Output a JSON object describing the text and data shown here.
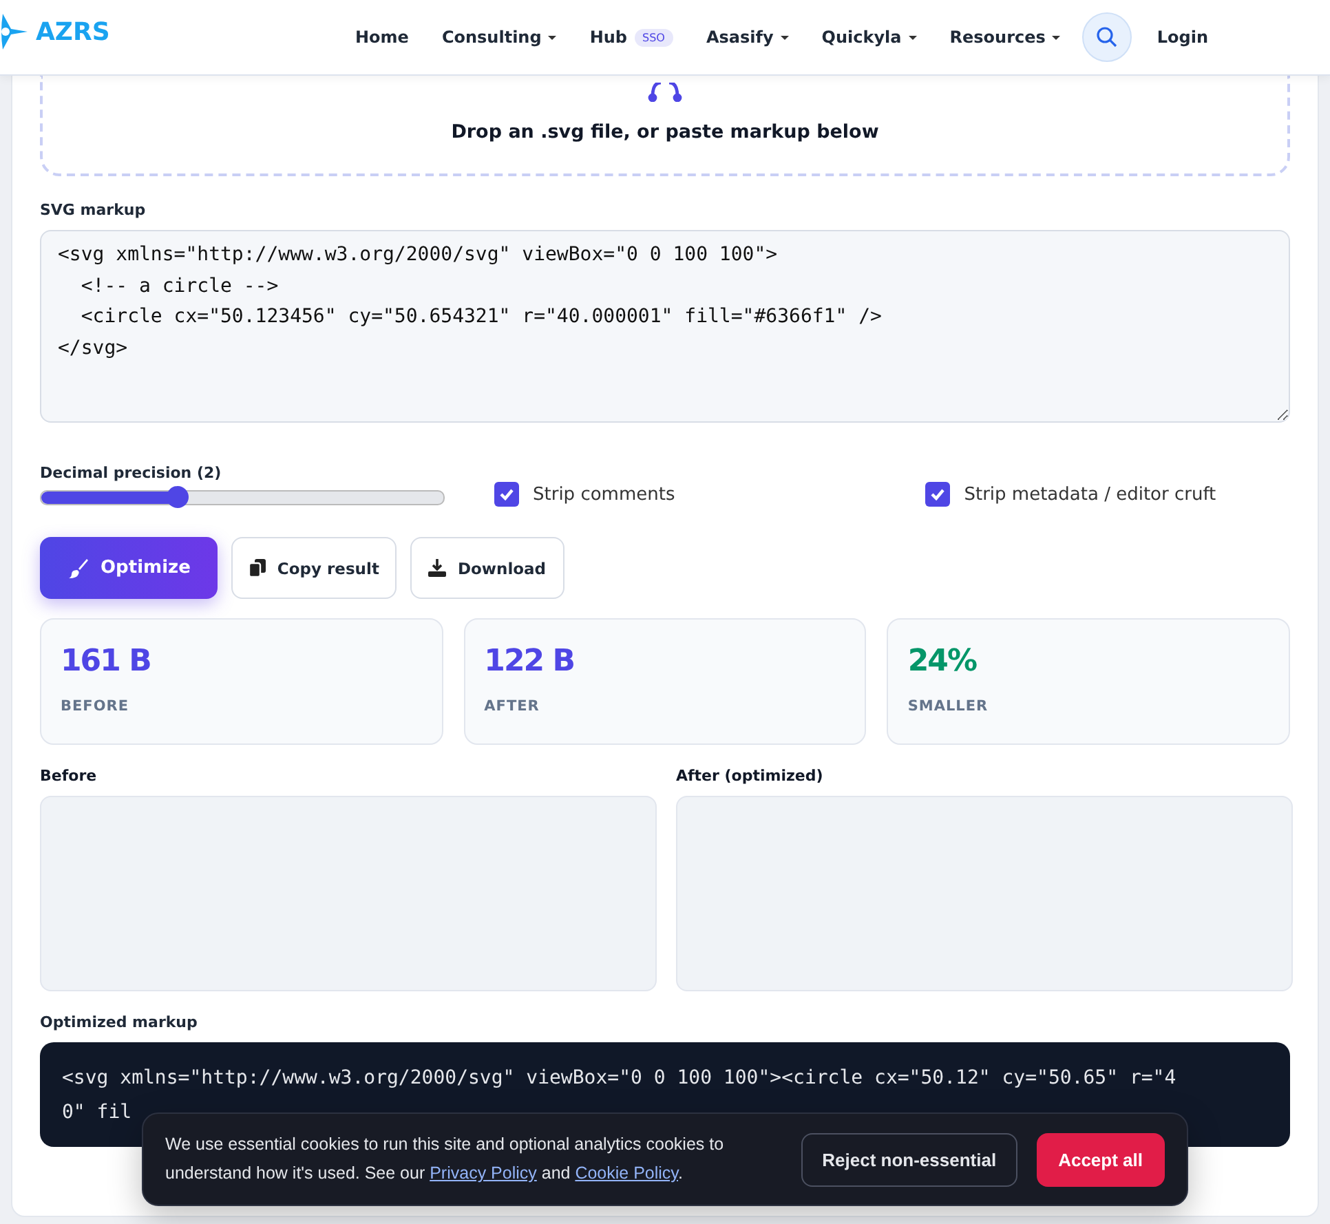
{
  "brand": {
    "name": "AZRS"
  },
  "nav": [
    {
      "label": "Home",
      "has_menu": false
    },
    {
      "label": "Consulting",
      "has_menu": true
    },
    {
      "label": "Hub",
      "has_menu": false,
      "badge": "SSO"
    },
    {
      "label": "Asasify",
      "has_menu": true
    },
    {
      "label": "Quickyla",
      "has_menu": true
    },
    {
      "label": "Resources",
      "has_menu": true
    }
  ],
  "login": "Login",
  "dropzone": {
    "text": "Drop an .svg file, or paste markup below"
  },
  "markup": {
    "label": "SVG markup",
    "value": "<svg xmlns=\"http://www.w3.org/2000/svg\" viewBox=\"0 0 100 100\">\n  <!-- a circle -->\n  <circle cx=\"50.123456\" cy=\"50.654321\" r=\"40.000001\" fill=\"#6366f1\" />\n</svg>"
  },
  "precision": {
    "label": "Decimal precision (2)",
    "level": 0.34
  },
  "options": [
    {
      "label": "Strip comments",
      "checked": true
    },
    {
      "label": "Strip metadata / editor cruft",
      "checked": true
    }
  ],
  "buttons": [
    {
      "label": "Optimize",
      "kind": "primary"
    },
    {
      "label": "Copy result",
      "kind": "secondary"
    },
    {
      "label": "Download",
      "kind": "secondary"
    }
  ],
  "stats": [
    {
      "value": "161 B",
      "label": "BEFORE",
      "color": "#4f46e5"
    },
    {
      "value": "122 B",
      "label": "AFTER",
      "color": "#4f46e5"
    },
    {
      "value": "24%",
      "label": "SMALLER",
      "color": "#059669"
    }
  ],
  "previews": [
    {
      "label": "Before"
    },
    {
      "label": "After (optimized)"
    }
  ],
  "output": {
    "label": "Optimized markup",
    "lines": [
      "<svg xmlns=\"http://www.w3.org/2000/svg\" viewBox=\"0 0 100 100\"><circle cx=\"50.12\" cy=\"50.65\" r=\"4",
      "0\" fil"
    ]
  },
  "cookie": {
    "parts": [
      {
        "kind": "text",
        "text": "We use essential cookies to run this site and optional analytics cookies to understand how it's used. See our "
      },
      {
        "kind": "link",
        "text": "Privacy Policy"
      },
      {
        "kind": "text",
        "text": " and "
      },
      {
        "kind": "link",
        "text": "Cookie Policy"
      },
      {
        "kind": "text",
        "text": "."
      }
    ],
    "reject": "Reject non-essential",
    "accept": "Accept all"
  }
}
